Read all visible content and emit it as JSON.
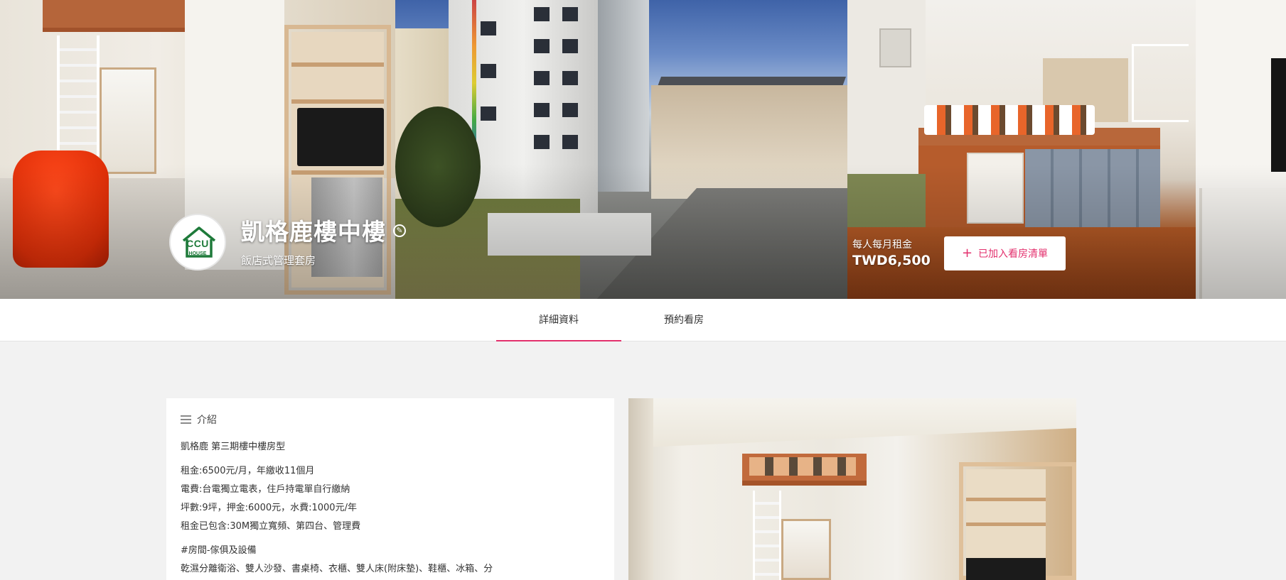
{
  "listing": {
    "logo_text": "CCU",
    "logo_subtext": "HOUSE",
    "title": "凱格鹿樓中樓",
    "subtitle": "飯店式管理套房",
    "rent_label": "每人每月租金",
    "rent_value": "TWD6,500",
    "watchlist_button": "已加入看房清單"
  },
  "tabs": [
    {
      "label": "詳細資料",
      "active": true
    },
    {
      "label": "預約看房",
      "active": false
    }
  ],
  "intro": {
    "heading": "介紹",
    "lines": [
      "凱格鹿 第三期樓中樓房型",
      "租金:6500元/月，年繳收11個月",
      "電費:台電獨立電表，住戶持電單自行繳納",
      "坪數:9坪，押金:6000元，水費:1000元/年",
      "租金已包含:30M獨立寬頻、第四台、管理費",
      "#房間-傢俱及設備",
      "乾濕分離衛浴、雙人沙發、書桌椅、衣櫃、雙人床(附床墊)、鞋櫃、冰箱、分"
    ]
  },
  "colors": {
    "accent": "#e3306d",
    "logo_green": "#1e7a3a"
  },
  "icons": [
    "edit-icon",
    "plus-icon",
    "menu-lines-icon",
    "house-logo-icon"
  ]
}
